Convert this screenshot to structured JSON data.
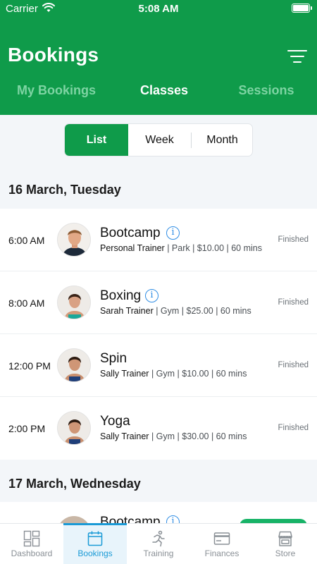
{
  "status_bar": {
    "carrier": "Carrier",
    "time": "5:08 AM"
  },
  "header": {
    "title": "Bookings",
    "tabs": [
      {
        "label": "My Bookings",
        "active": false
      },
      {
        "label": "Classes",
        "active": true
      },
      {
        "label": "Sessions",
        "active": false
      }
    ]
  },
  "view_toggle": {
    "options": [
      "List",
      "Week",
      "Month"
    ],
    "selected": "List"
  },
  "days": [
    {
      "label": "16 March, Tuesday",
      "classes": [
        {
          "time": "6:00 AM",
          "name": "Bootcamp",
          "trainer": "Personal Trainer",
          "details": " | Park | $10.00 | 60 mins",
          "status": "Finished",
          "avatar": "male-trainer"
        },
        {
          "time": "8:00 AM",
          "name": "Boxing",
          "trainer": "Sarah Trainer",
          "details": " | Gym | $25.00 | 60 mins",
          "status": "Finished",
          "avatar": "female-trainer"
        },
        {
          "time": "12:00 PM",
          "name": "Spin",
          "trainer": "Sally Trainer",
          "details": " | Gym | $10.00 | 60 mins",
          "status": "Finished",
          "avatar": "female-trainer"
        },
        {
          "time": "2:00 PM",
          "name": "Yoga",
          "trainer": "Sally Trainer",
          "details": " | Gym | $30.00 | 60 mins",
          "status": "Finished",
          "avatar": "female-trainer"
        }
      ]
    },
    {
      "label": "17 March, Wednesday",
      "classes": [
        {
          "name": "Bootcamp"
        }
      ]
    }
  ],
  "bottom_nav": [
    {
      "label": "Dashboard",
      "icon": "dashboard-icon",
      "active": false
    },
    {
      "label": "Bookings",
      "icon": "calendar-icon",
      "active": true
    },
    {
      "label": "Training",
      "icon": "running-person-icon",
      "active": false
    },
    {
      "label": "Finances",
      "icon": "credit-card-icon",
      "active": false
    },
    {
      "label": "Store",
      "icon": "store-icon",
      "active": false
    }
  ],
  "colors": {
    "brand_green": "#0f9b4a",
    "inactive_tab": "#7ed4a3",
    "nav_active": "#1a9ad6",
    "info_blue": "#2f8de4"
  }
}
